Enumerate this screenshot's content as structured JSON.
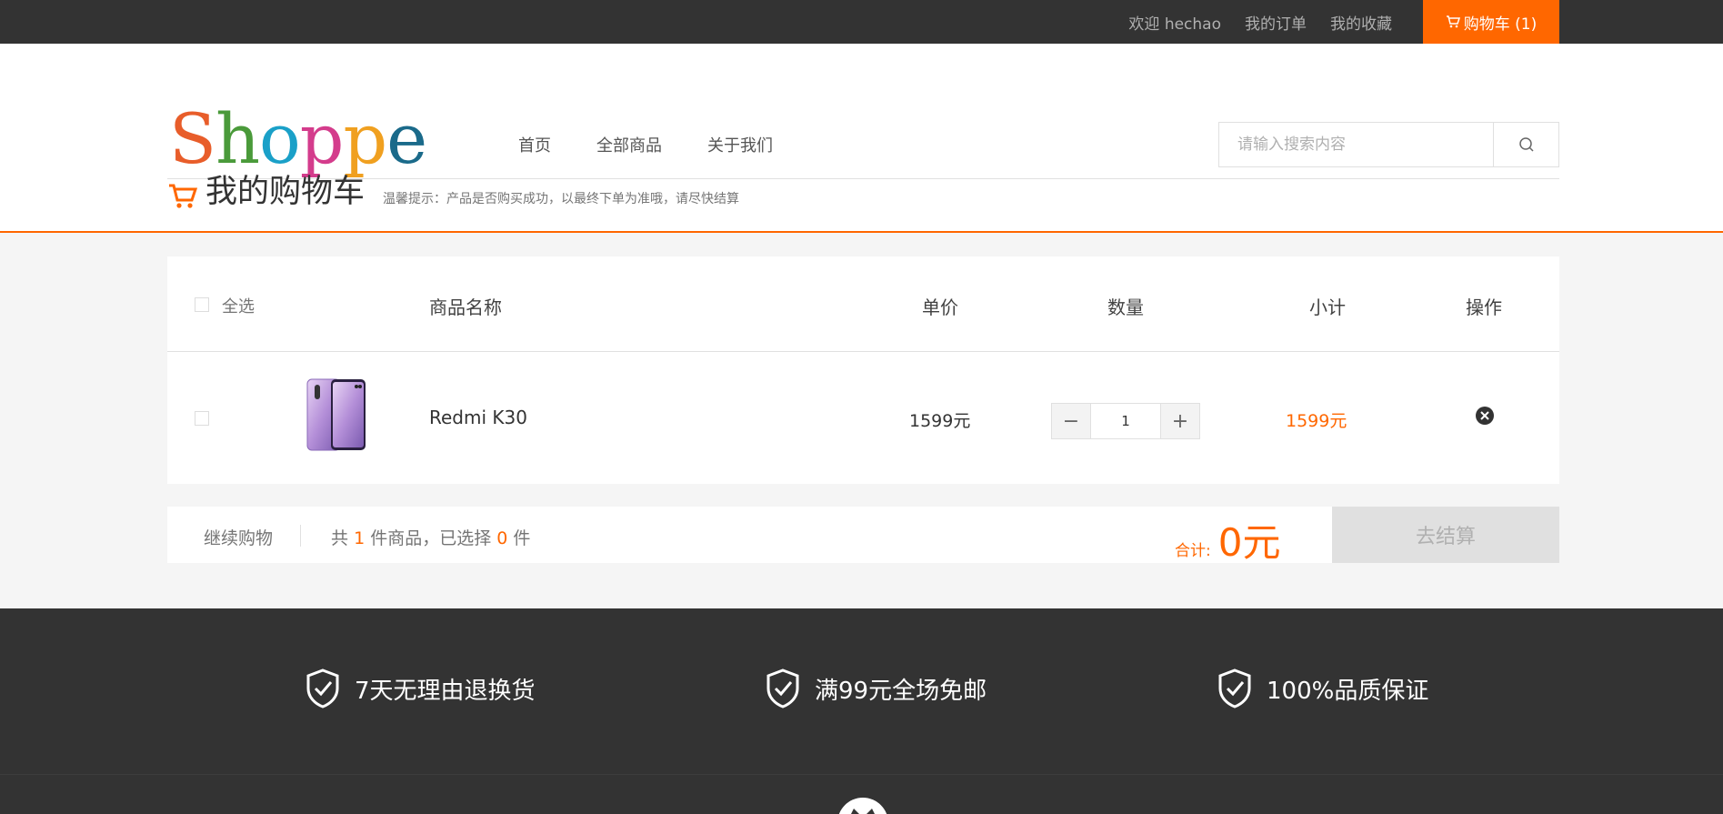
{
  "topbar": {
    "welcome": "欢迎 hechao",
    "orders": "我的订单",
    "favorites": "我的收藏",
    "cart": "购物车 (1)"
  },
  "header": {
    "logo": [
      "S",
      "h",
      "o",
      "p",
      "p",
      "e"
    ],
    "logo_colors": [
      "#e85d2a",
      "#4a9a3a",
      "#1aa0c8",
      "#d43c8c",
      "#f0a020",
      "#1a6a8a"
    ],
    "nav": [
      "首页",
      "全部商品",
      "关于我们"
    ],
    "search_placeholder": "请输入搜索内容"
  },
  "cart": {
    "title": "我的购物车",
    "tip": "温馨提示：产品是否购买成功，以最终下单为准哦，请尽快结算",
    "columns": {
      "select_all": "全选",
      "name": "商品名称",
      "price": "单价",
      "qty": "数量",
      "subtotal": "小计",
      "action": "操作"
    },
    "items": [
      {
        "name": "Redmi K30",
        "price": "1599元",
        "qty": "1",
        "subtotal": "1599元"
      }
    ],
    "continue": "继续购物",
    "count_prefix": "共",
    "count_total": "1",
    "count_mid": "件商品，已选择",
    "count_selected": "0",
    "count_suffix": "件",
    "total_label": "合计:",
    "total_value": "0元",
    "checkout": "去结算"
  },
  "footer": {
    "services": [
      "7天无理由退换货",
      "满99元全场免邮",
      "100%品质保证"
    ]
  },
  "colors": {
    "accent": "#ff6700",
    "dark": "#333333"
  }
}
